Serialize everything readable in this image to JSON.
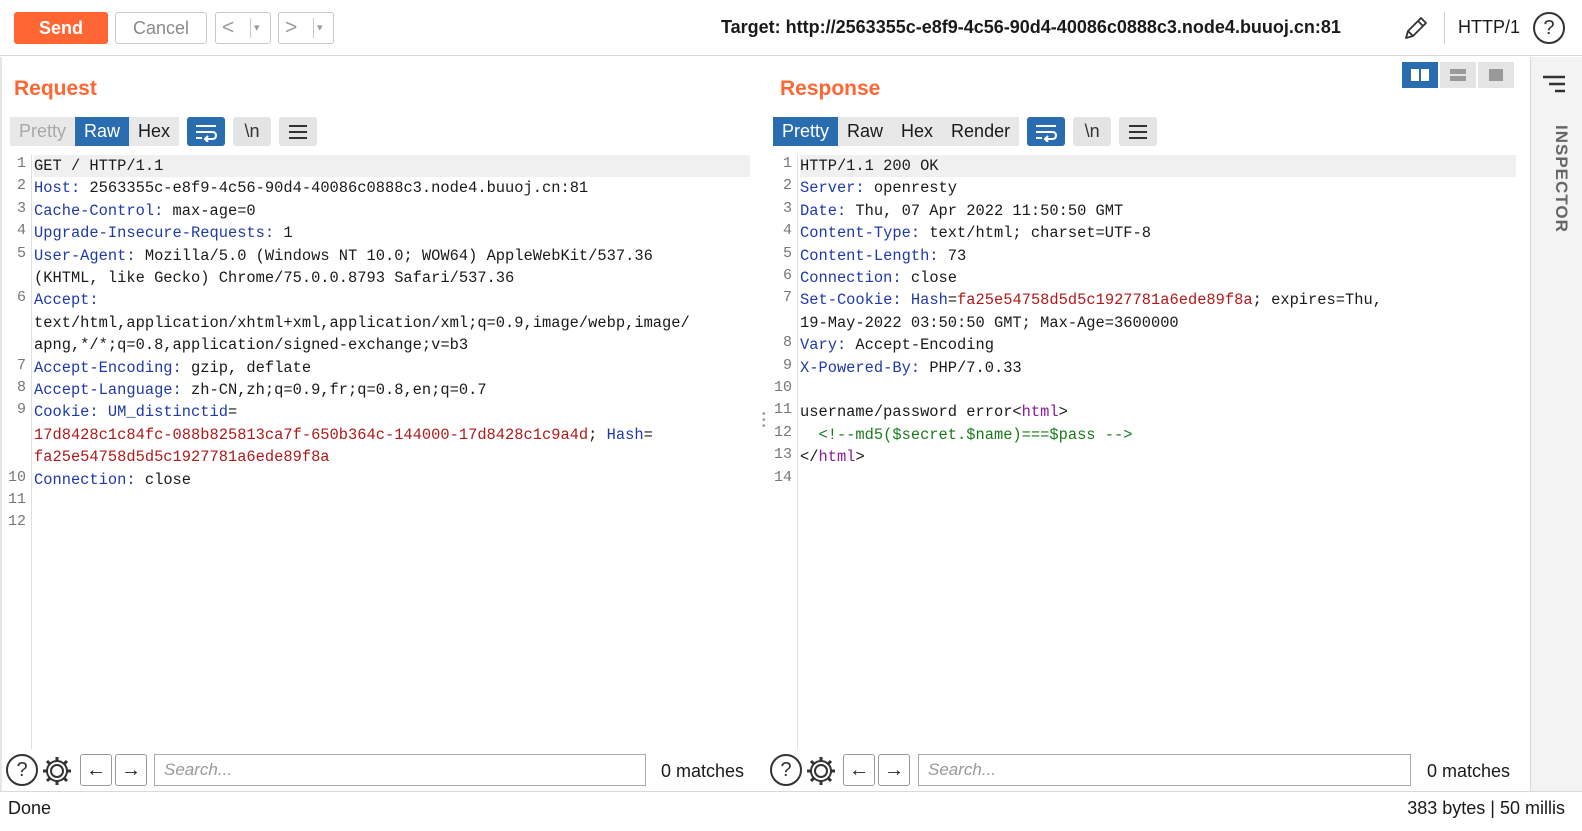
{
  "toolbar": {
    "send_label": "Send",
    "cancel_label": "Cancel",
    "back_glyph": "<",
    "forward_glyph": ">",
    "dropdown_glyph": "▾",
    "target_text": "Target: http://2563355c-e8f9-4c56-90d4-40086c0888c3.node4.buuoj.cn:81",
    "edit_icon": "pencil-icon",
    "http_version": "HTTP/1",
    "help_glyph": "?",
    "send_color": "#ff6633"
  },
  "request": {
    "title": "Request",
    "tabs": [
      "Pretty",
      "Raw",
      "Hex"
    ],
    "active_tab": "Raw",
    "disabled_tab": "Pretty",
    "newline_label": "\\n",
    "lines": [
      {
        "n": "1",
        "parts": [
          [
            "t",
            "GET / HTTP/1.1"
          ]
        ]
      },
      {
        "n": "2",
        "parts": [
          [
            "k",
            "Host:"
          ],
          [
            "t",
            " 2563355c-e8f9-4c56-90d4-40086c0888c3.node4.buuoj.cn:81"
          ]
        ]
      },
      {
        "n": "3",
        "parts": [
          [
            "k",
            "Cache-Control:"
          ],
          [
            "t",
            " max-age=0"
          ]
        ]
      },
      {
        "n": "4",
        "parts": [
          [
            "k",
            "Upgrade-Insecure-Requests:"
          ],
          [
            "t",
            " 1"
          ]
        ]
      },
      {
        "n": "5",
        "parts": [
          [
            "k",
            "User-Agent:"
          ],
          [
            "t",
            " Mozilla/5.0 (Windows NT 10.0; WOW64) AppleWebKit/537.36"
          ]
        ]
      },
      {
        "n": "",
        "parts": [
          [
            "t",
            "(KHTML, like Gecko) Chrome/75.0.0.8793 Safari/537.36"
          ]
        ]
      },
      {
        "n": "6",
        "parts": [
          [
            "k",
            "Accept:"
          ]
        ]
      },
      {
        "n": "",
        "parts": [
          [
            "t",
            "text/html,application/xhtml+xml,application/xml;q=0.9,image/webp,image/"
          ]
        ]
      },
      {
        "n": "",
        "parts": [
          [
            "t",
            "apng,*/*;q=0.8,application/signed-exchange;v=b3"
          ]
        ]
      },
      {
        "n": "7",
        "parts": [
          [
            "k",
            "Accept-Encoding:"
          ],
          [
            "t",
            " gzip, deflate"
          ]
        ]
      },
      {
        "n": "8",
        "parts": [
          [
            "k",
            "Accept-Language:"
          ],
          [
            "t",
            " zh-CN,zh;q=0.9,fr;q=0.8,en;q=0.7"
          ]
        ]
      },
      {
        "n": "9",
        "parts": [
          [
            "k",
            "Cookie:"
          ],
          [
            "t",
            " "
          ],
          [
            "k",
            "UM_distinctid"
          ],
          [
            "t",
            "="
          ]
        ]
      },
      {
        "n": "",
        "parts": [
          [
            "cv",
            "17d8428c1c84fc-088b825813ca7f-650b364c-144000-17d8428c1c9a4d"
          ],
          [
            "t",
            "; "
          ],
          [
            "k",
            "Hash"
          ],
          [
            "t",
            "="
          ]
        ]
      },
      {
        "n": "",
        "parts": [
          [
            "cv",
            "fa25e54758d5d5c1927781a6ede89f8a"
          ]
        ]
      },
      {
        "n": "10",
        "parts": [
          [
            "k",
            "Connection:"
          ],
          [
            "t",
            " close"
          ]
        ]
      },
      {
        "n": "11",
        "parts": []
      },
      {
        "n": "12",
        "parts": []
      }
    ],
    "search_placeholder": "Search...",
    "matches": "0 matches"
  },
  "response": {
    "title": "Response",
    "tabs": [
      "Pretty",
      "Raw",
      "Hex",
      "Render"
    ],
    "active_tab": "Pretty",
    "newline_label": "\\n",
    "lines": [
      {
        "n": "1",
        "parts": [
          [
            "t",
            "HTTP/1.1 200 OK"
          ]
        ]
      },
      {
        "n": "2",
        "parts": [
          [
            "k",
            "Server:"
          ],
          [
            "t",
            " openresty"
          ]
        ]
      },
      {
        "n": "3",
        "parts": [
          [
            "k",
            "Date:"
          ],
          [
            "t",
            " Thu, 07 Apr 2022 11:50:50 GMT"
          ]
        ]
      },
      {
        "n": "4",
        "parts": [
          [
            "k",
            "Content-Type:"
          ],
          [
            "t",
            " text/html; charset=UTF-8"
          ]
        ]
      },
      {
        "n": "5",
        "parts": [
          [
            "k",
            "Content-Length:"
          ],
          [
            "t",
            " 73"
          ]
        ]
      },
      {
        "n": "6",
        "parts": [
          [
            "k",
            "Connection:"
          ],
          [
            "t",
            " close"
          ]
        ]
      },
      {
        "n": "7",
        "parts": [
          [
            "k",
            "Set-Cookie:"
          ],
          [
            "t",
            " "
          ],
          [
            "k",
            "Hash"
          ],
          [
            "t",
            "="
          ],
          [
            "cv",
            "fa25e54758d5d5c1927781a6ede89f8a"
          ],
          [
            "t",
            "; expires=Thu,"
          ]
        ]
      },
      {
        "n": "",
        "parts": [
          [
            "t",
            "19-May-2022 03:50:50 GMT; Max-Age=3600000"
          ]
        ]
      },
      {
        "n": "8",
        "parts": [
          [
            "k",
            "Vary:"
          ],
          [
            "t",
            " Accept-Encoding"
          ]
        ]
      },
      {
        "n": "9",
        "parts": [
          [
            "k",
            "X-Powered-By:"
          ],
          [
            "t",
            " PHP/7.0.33"
          ]
        ]
      },
      {
        "n": "10",
        "parts": []
      },
      {
        "n": "11",
        "parts": [
          [
            "t",
            "username/password error<"
          ],
          [
            "tag",
            "html"
          ],
          [
            "t",
            ">"
          ]
        ]
      },
      {
        "n": "12",
        "parts": [
          [
            "cmt",
            "  <!--md5($secret.$name)===$pass -->"
          ]
        ]
      },
      {
        "n": "13",
        "parts": [
          [
            "t",
            "</"
          ],
          [
            "tag",
            "html"
          ],
          [
            "t",
            ">"
          ]
        ]
      },
      {
        "n": "14",
        "parts": []
      }
    ],
    "search_placeholder": "Search...",
    "matches": "0 matches"
  },
  "inspector": {
    "label": "INSPECTOR"
  },
  "status": {
    "left": "Done",
    "right": "383 bytes | 50 millis"
  },
  "colors": {
    "accent_orange": "#ff6633",
    "active_blue": "#2a6cb0",
    "header_key": "#1f3aa8",
    "cookie_value": "#b01a1a",
    "html_tag": "#8a1a9e",
    "comment": "#1a7a1a"
  }
}
